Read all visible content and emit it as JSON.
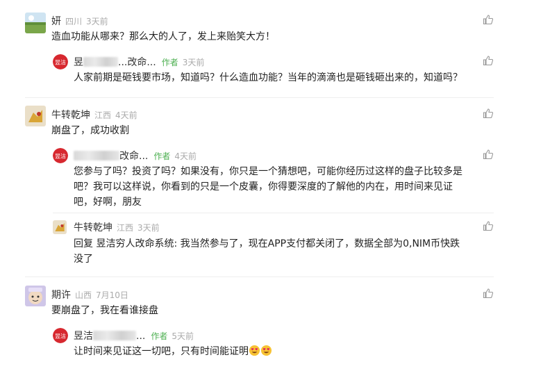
{
  "comments": [
    {
      "user": "妍",
      "location": "四川",
      "time": "3天前",
      "text": "造血功能从哪来？那么大的人了，发上来贻笑大方！",
      "reply": {
        "user_visible": "昱",
        "user_suffix": "...改命...",
        "author_badge": "作者",
        "time": "3天前",
        "text": "人家前期是砸钱要市场，知道吗？什么造血功能？当年的滴滴也是砸钱砸出来的，知道吗？"
      }
    },
    {
      "user": "牛转乾坤",
      "location": "江西",
      "time": "4天前",
      "text": "崩盘了，成功收割",
      "reply": {
        "user_visible": "",
        "user_suffix": "改命...",
        "author_badge": "作者",
        "time": "4天前",
        "text_lines": [
          "您参与了吗？投资了吗？如果没有，你只是一个猜想吧，可能你经历过这样的盘子比较多是",
          "吧？我可以这样说，你看到的只是一个皮囊，你得要深度的了解他的内在，用时间来见证",
          "吧，好啊，朋友"
        ]
      },
      "reply2": {
        "user": "牛转乾坤",
        "location": "江西",
        "time": "3天前",
        "reply_prefix": "回复",
        "reply_target": "昱洁穷人改命系统:",
        "text_line1": "我当然参与了，现在APP支付都关闭了，数据全部为0,NIM币快跌",
        "text_line2": "没了"
      }
    },
    {
      "user": "期许",
      "location": "山西",
      "time": "7月10日",
      "text": "要崩盘了，我在看谁接盘",
      "reply": {
        "user_visible": "昱洁",
        "user_suffix": "...",
        "author_badge": "作者",
        "time": "5天前",
        "text": "让时间来见证这一切吧，只有时间能证明"
      }
    }
  ],
  "badge_text": "昱洁",
  "colors": {
    "author": "#4caf50",
    "meta": "#aaaaaa",
    "badge_red": "#d7282f"
  }
}
